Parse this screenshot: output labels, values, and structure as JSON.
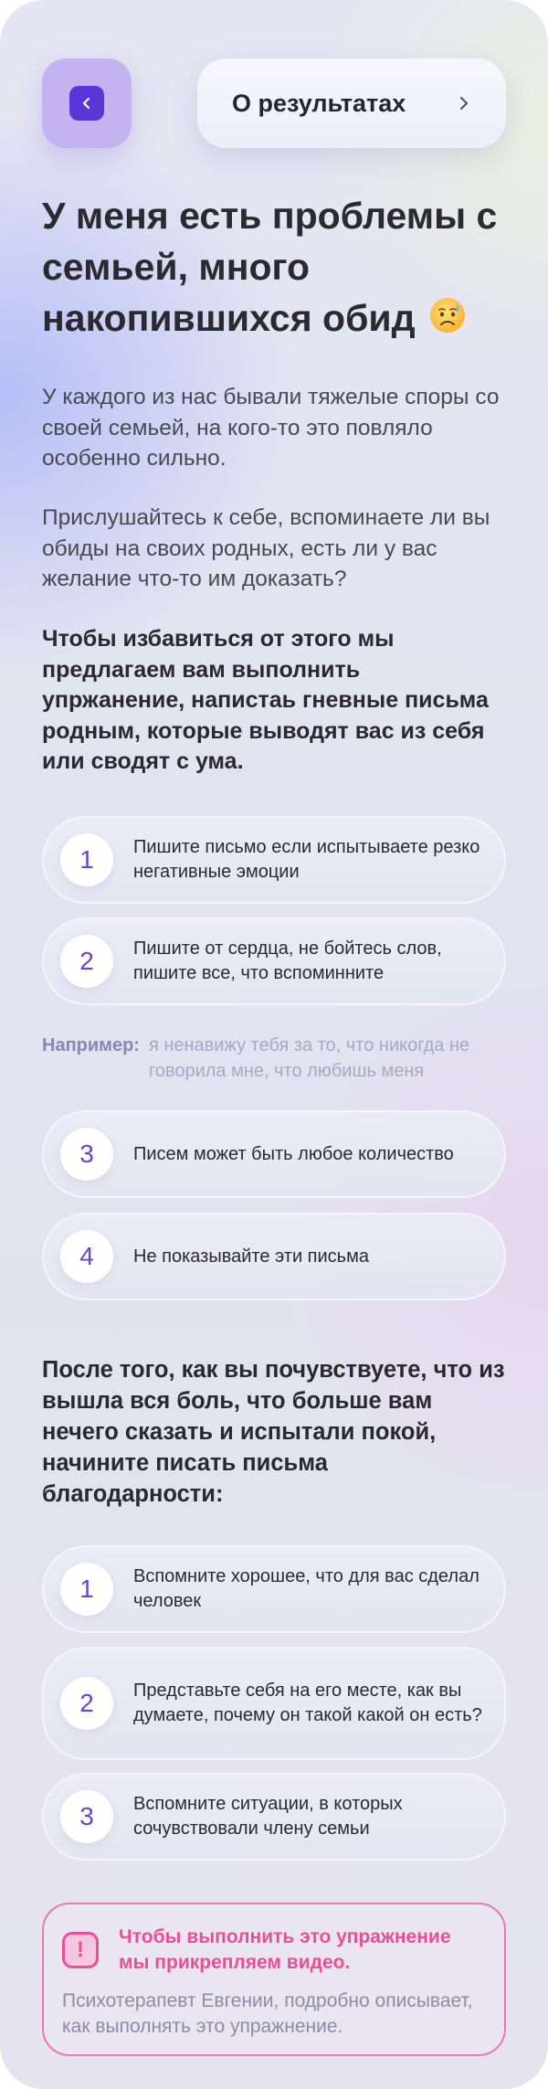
{
  "header": {
    "back_icon": "chevron-left-icon",
    "results_label": "О результатах",
    "results_icon": "chevron-right-icon"
  },
  "title": {
    "text": "У меня есть проблемы с семьей, много накопившихся обид",
    "emoji": "sad-face-emoji"
  },
  "paragraphs": [
    "У каждого из нас бывали тяжелые споры со своей семьей, на кого-то это повляло особенно сильно.",
    "Прислушайтесь к себе, вспоминаете ли вы обиды на своих родных, есть ли у вас желание что-то им доказать?",
    "Чтобы избавиться от этого мы предлагаем вам выполнить упржанение, напистаь гневные письма родным, которые выводят вас из себя или сводят с ума."
  ],
  "anger_steps": [
    {
      "num": "1",
      "text": "Пишите письмо если испытываете резко негативные эмоции"
    },
    {
      "num": "2",
      "text": "Пишите от сердца, не бойтесь слов, пишите все, что вспоминните"
    },
    {
      "num": "3",
      "text": "Писем может быть любое количество"
    },
    {
      "num": "4",
      "text": "Не показывайте эти письма"
    }
  ],
  "example": {
    "label": "Например:",
    "text": "я ненавижу тебя за то, что никогда не говорила мне, что любишь меня"
  },
  "gratitude_heading": "После того, как вы почувствуете, что из вышла вся боль, что больше вам нечего сказать и испытали покой, начините писать письма благодарности:",
  "gratitude_steps": [
    {
      "num": "1",
      "text": "Вспомните хорошее, что для вас сделал человек"
    },
    {
      "num": "2",
      "text": "Представьте себя на его месте, как вы думаете, почему он такой какой он есть?"
    },
    {
      "num": "3",
      "text": "Вспомните ситуации, в которых сочувствовали члену семьи"
    }
  ],
  "note": {
    "icon": "exclamation-icon",
    "icon_glyph": "!",
    "title": "Чтобы выполнить это упражнение мы прикрепляем видео.",
    "text": "Психотерапевт Евгении, подробно описывает, как выполнять это упражнение."
  },
  "colors": {
    "accent": "#5a35d8",
    "accent_light": "#c3b4f1",
    "pink": "#ea4e97",
    "number": "#6644d6"
  }
}
